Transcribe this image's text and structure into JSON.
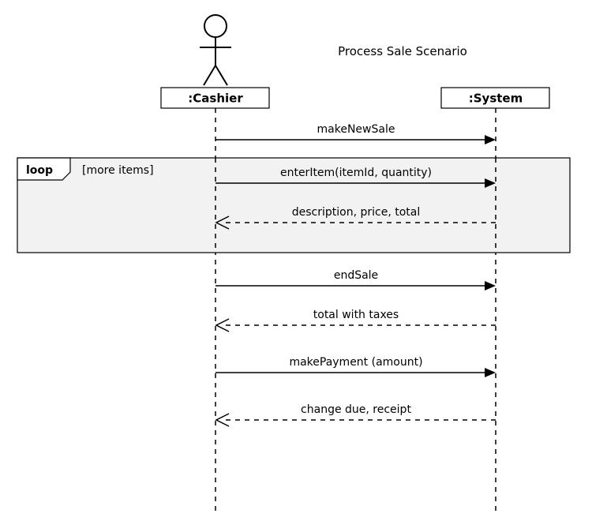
{
  "title": "Process Sale Scenario",
  "lifelines": {
    "cashier": ":Cashier",
    "system": ":System"
  },
  "fragment": {
    "operator": "loop",
    "guard": "[more items]"
  },
  "messages": {
    "m1": "makeNewSale",
    "m2": "enterItem(itemId, quantity)",
    "m3": "description, price, total",
    "m4": "endSale",
    "m5": "total with taxes",
    "m6": "makePayment (amount)",
    "m7": "change due, receipt"
  }
}
